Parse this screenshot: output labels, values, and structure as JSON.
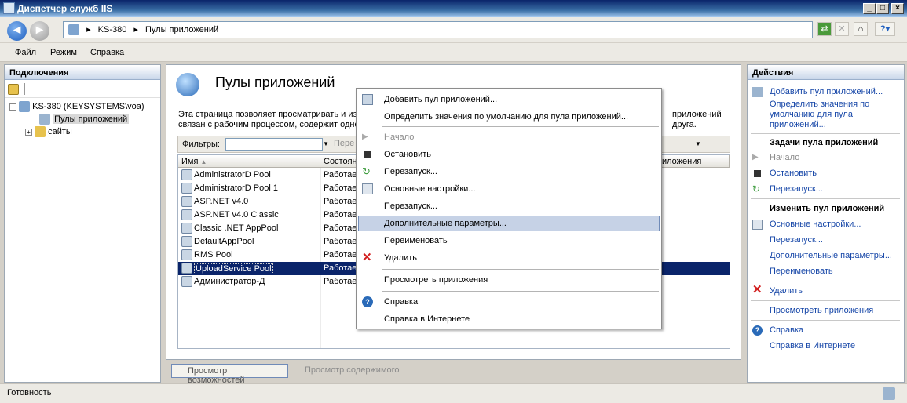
{
  "window": {
    "title": "Диспетчер служб IIS",
    "min": "_",
    "max": "□",
    "close": "×"
  },
  "address": {
    "parts": [
      "KS-380",
      "Пулы приложений"
    ]
  },
  "menu": [
    "Файл",
    "Режим",
    "Справка"
  ],
  "left": {
    "header": "Подключения",
    "server": "KS-380 (KEYSYSTEMS\\voa)",
    "pools": "Пулы приложений",
    "sites": "сайты"
  },
  "center": {
    "title": "Пулы приложений",
    "desc1a": "Эта страница позволяет просматривать и из",
    "desc1b": "приложений",
    "desc2a": "связан с рабочим процессом, содержит одно",
    "desc2b": "друга.",
    "filter_label": "Фильтры:",
    "filter_go": "Пере",
    "columns": [
      "Имя",
      "Состоян",
      "иложения"
    ],
    "rows": [
      {
        "name": "AdministratorD Pool",
        "state": "Работае"
      },
      {
        "name": "AdministratorD Pool  1",
        "state": "Работае"
      },
      {
        "name": "ASP.NET v4.0",
        "state": "Работае"
      },
      {
        "name": "ASP.NET v4.0 Classic",
        "state": "Работае"
      },
      {
        "name": "Classic .NET AppPool",
        "state": "Работае"
      },
      {
        "name": "DefaultAppPool",
        "state": "Работае"
      },
      {
        "name": "RMS Pool",
        "state": "Работае"
      },
      {
        "name": "UploadService Pool",
        "state": "Работае"
      },
      {
        "name": "Администратор-Д",
        "state": "Работае"
      }
    ],
    "tab_features": "Просмотр возможностей",
    "tab_content": "Просмотр содержимого"
  },
  "context_menu": [
    "Добавить пул приложений...",
    "Определить значения по умолчанию для пула приложений...",
    "Начало",
    "Остановить",
    "Перезапуск...",
    "Основные настройки...",
    "Перезапуск...",
    "Дополнительные параметры...",
    "Переименовать",
    "Удалить",
    "Просмотреть приложения",
    "Справка",
    "Справка в Интернете"
  ],
  "actions": {
    "header": "Действия",
    "add": "Добавить пул приложений...",
    "defaults": [
      "Определить значения по",
      "умолчанию для пула",
      "приложений..."
    ],
    "tasks_title": "Задачи пула приложений",
    "start": "Начало",
    "stop": "Остановить",
    "recycle": "Перезапуск...",
    "edit_title": "Изменить пул приложений",
    "basic": "Основные настройки...",
    "recycle2": "Перезапуск...",
    "advanced": "Дополнительные параметры...",
    "rename": "Переименовать",
    "remove": "Удалить",
    "view_apps": "Просмотреть приложения",
    "help": "Справка",
    "help_online": "Справка в Интернете"
  },
  "status": "Готовность",
  "colors": {
    "link": "#1747a8",
    "selection": "#0a246a",
    "menu_highlight": "#c6d2e6"
  }
}
